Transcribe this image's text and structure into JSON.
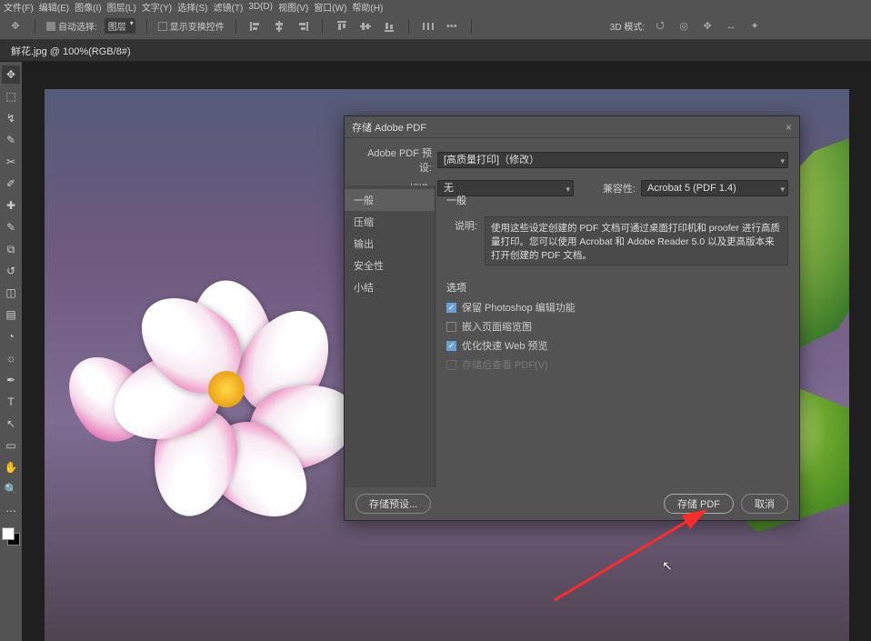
{
  "menubar": {
    "items": [
      "文件(F)",
      "编辑(E)",
      "图像(I)",
      "图层(L)",
      "文字(Y)",
      "选择(S)",
      "滤镜(T)",
      "3D(D)",
      "视图(V)",
      "窗口(W)",
      "帮助(H)"
    ]
  },
  "optionsbar": {
    "auto_select_label": "自动选择:",
    "auto_select_value": "图层",
    "show_transform_label": "显示变换控件",
    "mode_3d_label": "3D 模式:"
  },
  "tab": {
    "title": "鲜花.jpg @ 100%(RGB/8#)"
  },
  "dialog": {
    "title": "存储 Adobe PDF",
    "preset_label": "Adobe PDF 预设:",
    "preset_value": "[高质量打印]（修改）",
    "standard_label": "标准:",
    "standard_value": "无",
    "compat_label": "兼容性:",
    "compat_value": "Acrobat 5 (PDF 1.4)",
    "sidebar": {
      "items": [
        "一般",
        "压缩",
        "输出",
        "安全性",
        "小结"
      ]
    },
    "content": {
      "section_title": "一般",
      "desc_label": "说明:",
      "description": "使用这些设定创建的 PDF 文档可通过桌面打印机和 proofer 进行高质量打印。您可以使用 Acrobat 和 Adobe Reader 5.0 以及更高版本来打开创建的 PDF 文档。",
      "options_title": "选项",
      "opt1": "保留 Photoshop 编辑功能",
      "opt2": "嵌入页面缩览图",
      "opt3": "优化快速 Web 预览",
      "opt4": "存储后查看 PDF(V)"
    },
    "footer": {
      "save_preset": "存储预设...",
      "save_pdf": "存储 PDF",
      "cancel": "取消"
    }
  }
}
